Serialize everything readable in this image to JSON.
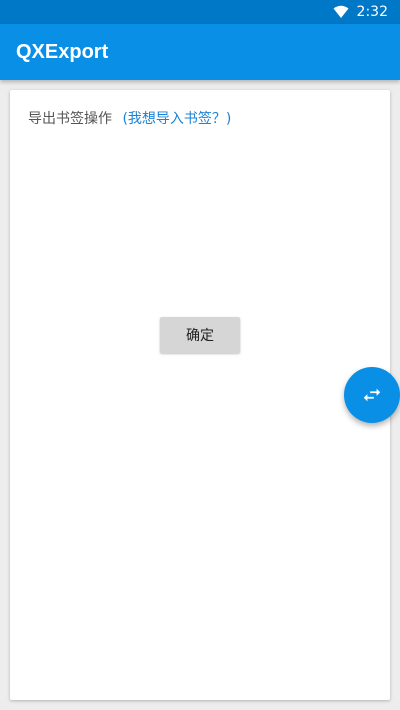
{
  "status_bar": {
    "time": "2:32",
    "wifi_icon": "wifi-icon"
  },
  "app_bar": {
    "title": "QXExport"
  },
  "card": {
    "heading": "导出书签操作",
    "switch_link": "(我想导入书签？)",
    "confirm_label": "确定"
  },
  "fab": {
    "icon": "swap-arrows-icon"
  },
  "colors": {
    "status_bar": "#0078c8",
    "app_bar": "#0a8fe6",
    "link": "#1a83d6",
    "button": "#d6d6d6",
    "background": "#ededed"
  }
}
